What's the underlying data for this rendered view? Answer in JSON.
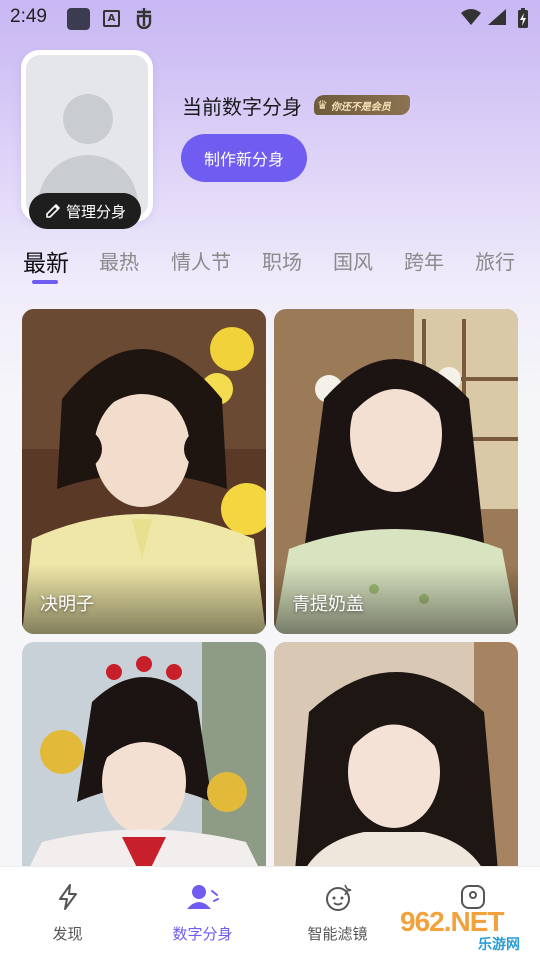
{
  "status_bar": {
    "time": "2:49",
    "icons": [
      "app-icon",
      "a-icon",
      "bug-icon",
      "wifi-icon",
      "signal-icon",
      "battery-charging-icon"
    ]
  },
  "profile": {
    "title": "当前数字分身",
    "member_badge": "你还不是会员",
    "create_button": "制作新分身",
    "manage_button": "管理分身"
  },
  "tabs": [
    {
      "label": "最新",
      "active": true
    },
    {
      "label": "最热",
      "active": false
    },
    {
      "label": "情人节",
      "active": false
    },
    {
      "label": "职场",
      "active": false
    },
    {
      "label": "国风",
      "active": false
    },
    {
      "label": "跨年",
      "active": false
    },
    {
      "label": "旅行",
      "active": false
    }
  ],
  "cards": [
    {
      "caption": "决明子"
    },
    {
      "caption": "青提奶盖"
    },
    {
      "caption": ""
    },
    {
      "caption": ""
    }
  ],
  "bottom_nav": [
    {
      "label": "发现",
      "icon": "lightning-icon",
      "active": false
    },
    {
      "label": "数字分身",
      "icon": "user-avatar-icon",
      "active": true
    },
    {
      "label": "智能滤镜",
      "icon": "face-filter-icon",
      "active": false
    },
    {
      "label": "",
      "icon": "profile-icon",
      "active": false
    }
  ],
  "watermark": {
    "main": "962.NET",
    "sub": "乐游网"
  },
  "colors": {
    "accent": "#6f5cf0",
    "badge": "#6e5a3c"
  }
}
